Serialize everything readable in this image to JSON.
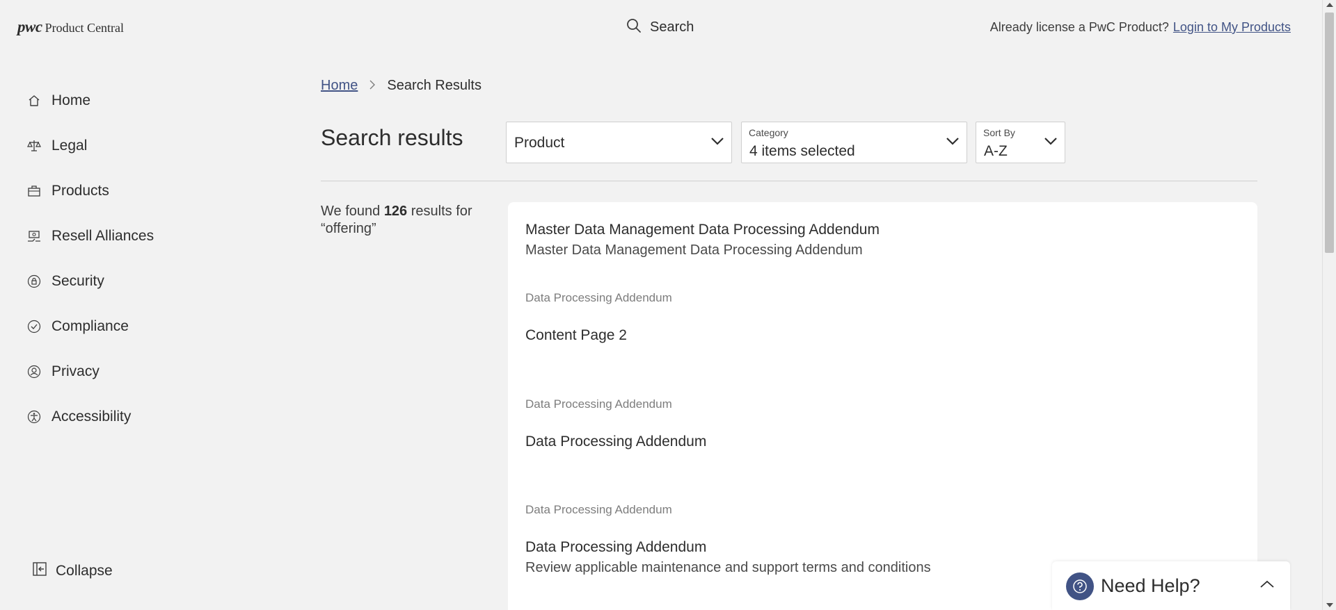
{
  "header": {
    "logo_mark": "pwc",
    "logo_text": "Product Central",
    "search_label": "Search",
    "license_question": "Already license a PwC Product?",
    "login_link": "Login to My Products"
  },
  "sidebar": {
    "items": [
      {
        "label": "Home",
        "icon": "home-icon"
      },
      {
        "label": "Legal",
        "icon": "scales-icon"
      },
      {
        "label": "Products",
        "icon": "briefcase-icon"
      },
      {
        "label": "Resell Alliances",
        "icon": "handshake-icon"
      },
      {
        "label": "Security",
        "icon": "lock-icon"
      },
      {
        "label": "Compliance",
        "icon": "check-circle-icon"
      },
      {
        "label": "Privacy",
        "icon": "user-shield-icon"
      },
      {
        "label": "Accessibility",
        "icon": "accessibility-icon"
      }
    ],
    "collapse_label": "Collapse"
  },
  "breadcrumb": {
    "home": "Home",
    "current": "Search Results"
  },
  "main": {
    "title": "Search results",
    "filters": {
      "product": {
        "value": "Product"
      },
      "category": {
        "label": "Category",
        "value": "4 items selected"
      },
      "sort": {
        "label": "Sort By",
        "value": "A-Z"
      }
    },
    "found": {
      "prefix": "We found",
      "count": "126",
      "suffix": "results for",
      "query": "“offering”"
    },
    "results": [
      {
        "category": "",
        "title": "Master Data Management Data Processing Addendum",
        "desc": "Master Data Management Data Processing Addendum"
      },
      {
        "category": "Data Processing Addendum",
        "title": "Content Page 2",
        "desc": ""
      },
      {
        "category": "Data Processing Addendum",
        "title": "Data Processing Addendum",
        "desc": ""
      },
      {
        "category": "Data Processing Addendum",
        "title": "Data Processing Addendum",
        "desc": "Review applicable maintenance and support terms and conditions"
      }
    ]
  },
  "help": {
    "label": "Need Help?"
  },
  "colors": {
    "background": "#f2f2f2",
    "link": "#415385",
    "text": "#2d2d2d",
    "muted": "#7d7d7d"
  }
}
